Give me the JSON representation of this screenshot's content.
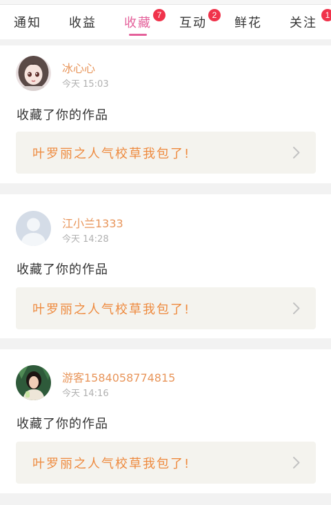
{
  "tabs": [
    {
      "label": "通知",
      "badge": null,
      "active": false
    },
    {
      "label": "收益",
      "badge": null,
      "active": false
    },
    {
      "label": "收藏",
      "badge": "7",
      "active": true
    },
    {
      "label": "互动",
      "badge": "2",
      "active": false
    },
    {
      "label": "鲜花",
      "badge": null,
      "active": false
    },
    {
      "label": "关注",
      "badge": "1",
      "active": false
    }
  ],
  "colors": {
    "accent": "#e4609a",
    "badge": "#f0334b",
    "username": "#e8955a",
    "work_title": "#ee8a3e",
    "work_bg": "#f4f3ee"
  },
  "notifications": [
    {
      "avatar": "anime-girl-avatar",
      "username": "冰心心",
      "time": "今天 15:03",
      "message": "收藏了你的作品",
      "work_title": "叶罗丽之人气校草我包了!"
    },
    {
      "avatar": "default-user-avatar",
      "username": "江小兰1333",
      "time": "今天 14:28",
      "message": "收藏了你的作品",
      "work_title": "叶罗丽之人气校草我包了!"
    },
    {
      "avatar": "photo-girl-avatar",
      "username": "游客1584058774815",
      "time": "今天 14:16",
      "message": "收藏了你的作品",
      "work_title": "叶罗丽之人气校草我包了!"
    }
  ]
}
